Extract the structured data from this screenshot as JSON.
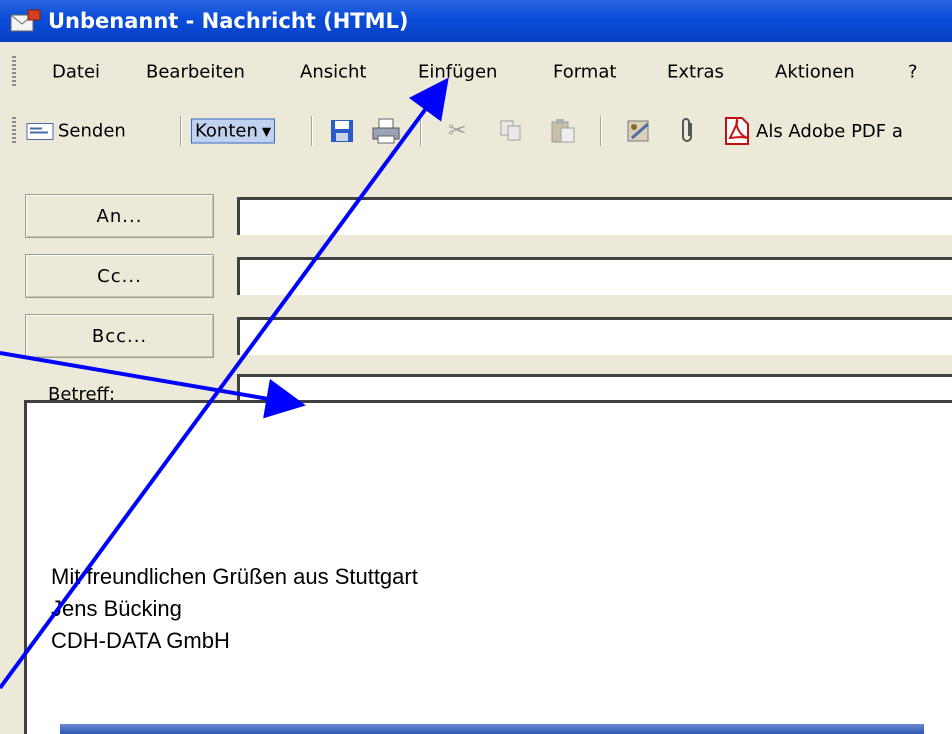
{
  "window": {
    "title": "Unbenannt - Nachricht (HTML)"
  },
  "menu": [
    "Datei",
    "Bearbeiten",
    "Ansicht",
    "Einfügen",
    "Format",
    "Extras",
    "Aktionen",
    "?"
  ],
  "toolbar": {
    "send_label": "Senden",
    "accounts_label": "Konten",
    "pdf_label": "Als Adobe PDF a"
  },
  "header": {
    "to_label": "An...",
    "cc_label": "Cc...",
    "bcc_label": "Bcc...",
    "subject_label": "Betreff:"
  },
  "body": {
    "lines": [
      "Mit freundlichen Grüßen aus Stuttgart",
      "Jens Bücking",
      "CDH-DATA GmbH"
    ]
  },
  "colors": {
    "titlebar": "#0a4cd8",
    "chrome": "#ece9d8",
    "annotation_arrows": "#0000ff"
  }
}
